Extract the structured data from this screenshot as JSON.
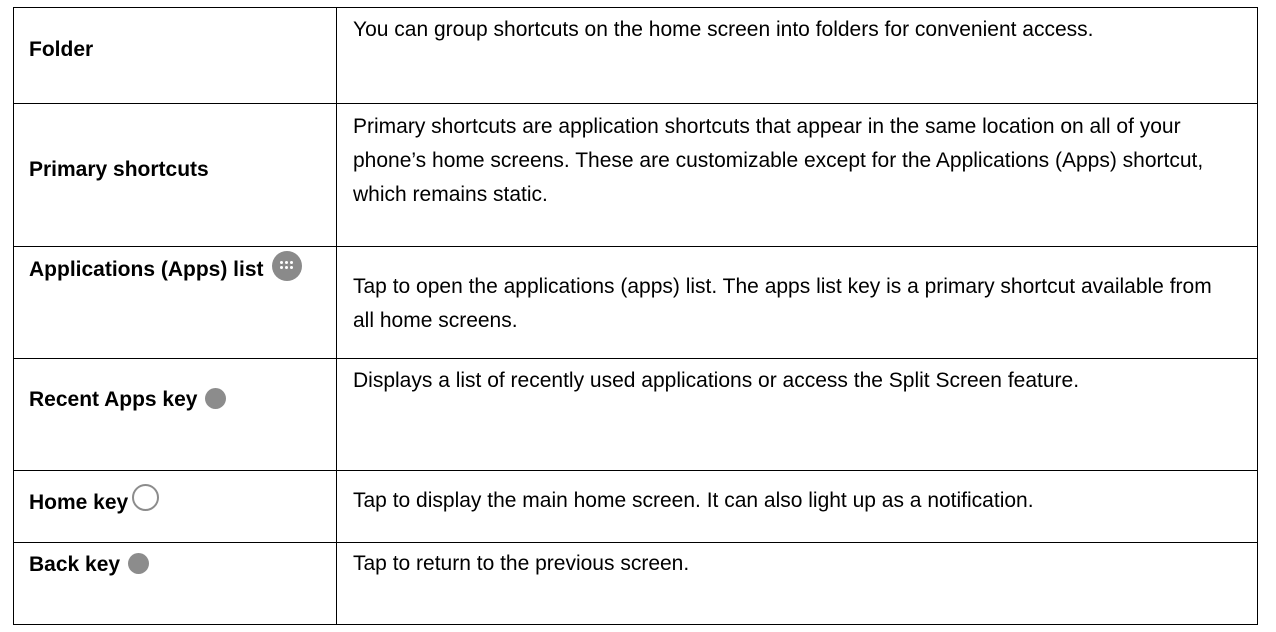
{
  "table": {
    "rows": [
      {
        "term": "Folder",
        "description": "You can group shortcuts on the home screen into folders for convenient access.",
        "icon": null
      },
      {
        "term": "Primary shortcuts",
        "description": "Primary shortcuts are application shortcuts that appear in the same location on all of your phone’s home screens. These are customizable except for the Applications (Apps) shortcut, which remains static.",
        "icon": null
      },
      {
        "term": "Applications (Apps) list",
        "description": "Tap to open the applications (apps) list. The apps list key is a primary shortcut available from all home screens.",
        "icon": "apps-grid-icon"
      },
      {
        "term": "Recent Apps key",
        "description": "Displays a list of recently used applications or access the Split Screen feature.",
        "icon": "gray-dot-icon"
      },
      {
        "term": "Home key",
        "description": "Tap to display the main home screen. It can also light up as a notification.",
        "icon": "home-circle-icon"
      },
      {
        "term": "Back key",
        "description": "Tap to return to the previous screen.",
        "icon": "gray-dot-icon"
      }
    ]
  },
  "colors": {
    "icon_gray": "#8c8c8c",
    "border": "#000000",
    "text": "#000000"
  }
}
